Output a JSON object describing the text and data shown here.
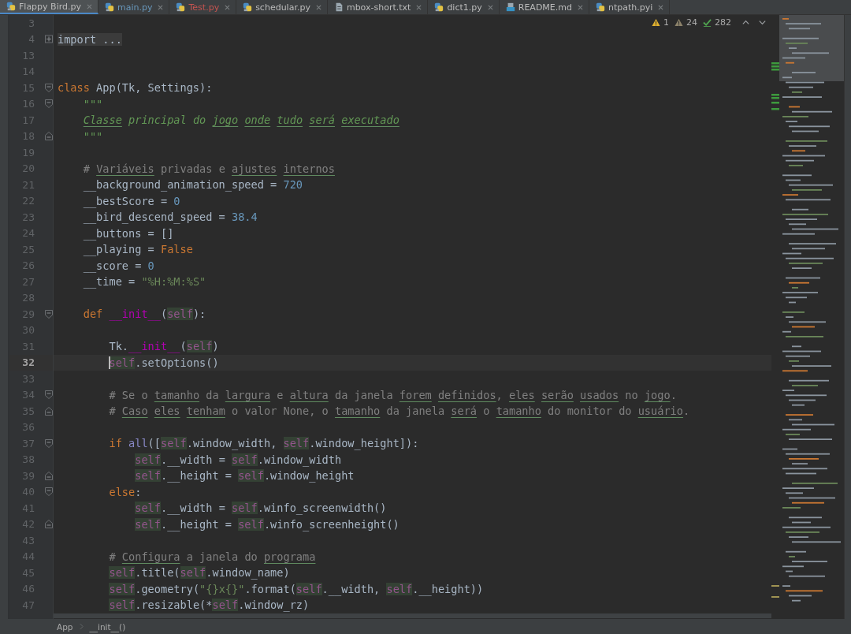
{
  "tabs": [
    {
      "label": "Flappy Bird.py",
      "kind": "py",
      "color": "#bbbbbb",
      "selected": true
    },
    {
      "label": "main.py",
      "kind": "py",
      "color": "#6897bb",
      "selected": false
    },
    {
      "label": "Test.py",
      "kind": "py",
      "color": "#c75450",
      "selected": false
    },
    {
      "label": "schedular.py",
      "kind": "py",
      "color": "#bbbbbb",
      "selected": false
    },
    {
      "label": "mbox-short.txt",
      "kind": "txt",
      "color": "#bbbbbb",
      "selected": false
    },
    {
      "label": "dict1.py",
      "kind": "py",
      "color": "#bbbbbb",
      "selected": false
    },
    {
      "label": "README.md",
      "kind": "md",
      "color": "#bbbbbb",
      "selected": false
    },
    {
      "label": "ntpath.pyi",
      "kind": "py",
      "color": "#bbbbbb",
      "selected": false
    }
  ],
  "inspections": [
    {
      "kind": "warning",
      "count": "1"
    },
    {
      "kind": "weak",
      "count": "24"
    },
    {
      "kind": "typo",
      "count": "282"
    }
  ],
  "lines": [
    {
      "no": "3",
      "current": false
    },
    {
      "no": "4",
      "current": false,
      "fold": {
        "kind": "collapsed"
      },
      "tokens": [
        {
          "t": "import ...",
          "kind": "folded"
        }
      ]
    },
    {
      "no": "13",
      "current": false
    },
    {
      "no": "14",
      "current": false
    },
    {
      "no": "15",
      "current": false,
      "fold": {
        "kind": "open"
      },
      "tokens": [
        {
          "t": "class ",
          "kind": "kw"
        },
        {
          "t": "App(Tk, Settings):",
          "kind": "p"
        }
      ]
    },
    {
      "no": "16",
      "current": false,
      "fold": {
        "kind": "open"
      },
      "tokens": [
        {
          "t": "    \"\"\"",
          "kind": "doc"
        }
      ]
    },
    {
      "no": "17",
      "current": false,
      "tokens": [
        {
          "t": "    Classe",
          "kind": "docu"
        },
        {
          "t": " principal do ",
          "kind": "doc"
        },
        {
          "t": "jogo",
          "kind": "docu"
        },
        {
          "t": " onde",
          "kind": "docu"
        },
        {
          "t": " tudo",
          "kind": "docu"
        },
        {
          "t": " será",
          "kind": "docu"
        },
        {
          "t": " executado",
          "kind": "docu"
        }
      ]
    },
    {
      "no": "18",
      "current": false,
      "fold": {
        "kind": "close"
      },
      "tokens": [
        {
          "t": "    \"\"\"",
          "kind": "doc"
        }
      ]
    },
    {
      "no": "19",
      "current": false
    },
    {
      "no": "20",
      "current": false,
      "tokens": [
        {
          "t": "    # ",
          "kind": "com"
        },
        {
          "t": "Variáveis",
          "kind": "comu"
        },
        {
          "t": " privadas e ",
          "kind": "com"
        },
        {
          "t": "ajustes",
          "kind": "comu"
        },
        {
          "t": " internos",
          "kind": "comu"
        }
      ]
    },
    {
      "no": "21",
      "current": false,
      "tokens": [
        {
          "t": "    __background_animation_speed = ",
          "kind": "p"
        },
        {
          "t": "720",
          "kind": "num"
        }
      ]
    },
    {
      "no": "22",
      "current": false,
      "tokens": [
        {
          "t": "    __bestScore = ",
          "kind": "p"
        },
        {
          "t": "0",
          "kind": "num"
        }
      ]
    },
    {
      "no": "23",
      "current": false,
      "tokens": [
        {
          "t": "    __bird_descend_speed = ",
          "kind": "p"
        },
        {
          "t": "38.4",
          "kind": "num"
        }
      ]
    },
    {
      "no": "24",
      "current": false,
      "tokens": [
        {
          "t": "    __buttons = []",
          "kind": "p"
        }
      ]
    },
    {
      "no": "25",
      "current": false,
      "tokens": [
        {
          "t": "    __playing = ",
          "kind": "p"
        },
        {
          "t": "False",
          "kind": "kw"
        }
      ]
    },
    {
      "no": "26",
      "current": false,
      "tokens": [
        {
          "t": "    __score = ",
          "kind": "p"
        },
        {
          "t": "0",
          "kind": "num"
        }
      ]
    },
    {
      "no": "27",
      "current": false,
      "tokens": [
        {
          "t": "    __time = ",
          "kind": "p"
        },
        {
          "t": "\"%H:%M:%S\"",
          "kind": "str"
        }
      ]
    },
    {
      "no": "28",
      "current": false
    },
    {
      "no": "29",
      "current": false,
      "fold": {
        "kind": "open"
      },
      "tokens": [
        {
          "t": "    def ",
          "kind": "kw"
        },
        {
          "t": "__init__",
          "kind": "magic"
        },
        {
          "t": "(",
          "kind": "p"
        },
        {
          "t": "self",
          "kind": "self"
        },
        {
          "t": "):",
          "kind": "p"
        }
      ]
    },
    {
      "no": "30",
      "current": false
    },
    {
      "no": "31",
      "current": false,
      "tokens": [
        {
          "t": "        Tk.",
          "kind": "p"
        },
        {
          "t": "__init__",
          "kind": "magic"
        },
        {
          "t": "(",
          "kind": "p"
        },
        {
          "t": "self",
          "kind": "self"
        },
        {
          "t": ")",
          "kind": "p"
        }
      ]
    },
    {
      "no": "32",
      "current": true,
      "tokens": [
        {
          "t": "        self",
          "kind": "self"
        },
        {
          "t": ".setOptions()",
          "kind": "p"
        }
      ]
    },
    {
      "no": "33",
      "current": false
    },
    {
      "no": "34",
      "current": false,
      "fold": {
        "kind": "open"
      },
      "tokens": [
        {
          "t": "        # Se o ",
          "kind": "com"
        },
        {
          "t": "tamanho",
          "kind": "comu"
        },
        {
          "t": " da ",
          "kind": "com"
        },
        {
          "t": "largura",
          "kind": "comu"
        },
        {
          "t": " e ",
          "kind": "com"
        },
        {
          "t": "altura",
          "kind": "comu"
        },
        {
          "t": " da janela ",
          "kind": "com"
        },
        {
          "t": "forem",
          "kind": "comu"
        },
        {
          "t": " definidos",
          "kind": "comu"
        },
        {
          "t": ", ",
          "kind": "com"
        },
        {
          "t": "eles",
          "kind": "comu"
        },
        {
          "t": " serão",
          "kind": "comu"
        },
        {
          "t": " usados",
          "kind": "comu"
        },
        {
          "t": " no ",
          "kind": "com"
        },
        {
          "t": "jogo",
          "kind": "comu"
        },
        {
          "t": ".",
          "kind": "com"
        }
      ]
    },
    {
      "no": "35",
      "current": false,
      "fold": {
        "kind": "close"
      },
      "tokens": [
        {
          "t": "        # ",
          "kind": "com"
        },
        {
          "t": "Caso",
          "kind": "comu"
        },
        {
          "t": " eles",
          "kind": "comu"
        },
        {
          "t": " tenham",
          "kind": "comu"
        },
        {
          "t": " o valor None, o ",
          "kind": "com"
        },
        {
          "t": "tamanho",
          "kind": "comu"
        },
        {
          "t": " da janela ",
          "kind": "com"
        },
        {
          "t": "será",
          "kind": "comu"
        },
        {
          "t": " o ",
          "kind": "com"
        },
        {
          "t": "tamanho",
          "kind": "comu"
        },
        {
          "t": " do monitor do ",
          "kind": "com"
        },
        {
          "t": "usuário",
          "kind": "comu"
        },
        {
          "t": ".",
          "kind": "com"
        }
      ]
    },
    {
      "no": "36",
      "current": false
    },
    {
      "no": "37",
      "current": false,
      "fold": {
        "kind": "open"
      },
      "tokens": [
        {
          "t": "        if ",
          "kind": "kw"
        },
        {
          "t": "all",
          "kind": "builtin"
        },
        {
          "t": "([",
          "kind": "p"
        },
        {
          "t": "self",
          "kind": "self"
        },
        {
          "t": ".window_width, ",
          "kind": "p"
        },
        {
          "t": "self",
          "kind": "self"
        },
        {
          "t": ".window_height]):",
          "kind": "p"
        }
      ]
    },
    {
      "no": "38",
      "current": false,
      "tokens": [
        {
          "t": "            self",
          "kind": "self"
        },
        {
          "t": ".__width = ",
          "kind": "p"
        },
        {
          "t": "self",
          "kind": "self"
        },
        {
          "t": ".window_width",
          "kind": "p"
        }
      ]
    },
    {
      "no": "39",
      "current": false,
      "fold": {
        "kind": "close"
      },
      "tokens": [
        {
          "t": "            self",
          "kind": "self"
        },
        {
          "t": ".__height = ",
          "kind": "p"
        },
        {
          "t": "self",
          "kind": "self"
        },
        {
          "t": ".window_height",
          "kind": "p"
        }
      ]
    },
    {
      "no": "40",
      "current": false,
      "fold": {
        "kind": "open"
      },
      "tokens": [
        {
          "t": "        else",
          "kind": "kw"
        },
        {
          "t": ":",
          "kind": "p"
        }
      ]
    },
    {
      "no": "41",
      "current": false,
      "tokens": [
        {
          "t": "            self",
          "kind": "self"
        },
        {
          "t": ".__width = ",
          "kind": "p"
        },
        {
          "t": "self",
          "kind": "self"
        },
        {
          "t": ".winfo_screenwidth()",
          "kind": "p"
        }
      ]
    },
    {
      "no": "42",
      "current": false,
      "fold": {
        "kind": "close"
      },
      "tokens": [
        {
          "t": "            self",
          "kind": "self"
        },
        {
          "t": ".__height = ",
          "kind": "p"
        },
        {
          "t": "self",
          "kind": "self"
        },
        {
          "t": ".winfo_screenheight()",
          "kind": "p"
        }
      ]
    },
    {
      "no": "43",
      "current": false
    },
    {
      "no": "44",
      "current": false,
      "tokens": [
        {
          "t": "        # ",
          "kind": "com"
        },
        {
          "t": "Configura",
          "kind": "comu"
        },
        {
          "t": " a janela do ",
          "kind": "com"
        },
        {
          "t": "programa",
          "kind": "comu"
        }
      ]
    },
    {
      "no": "45",
      "current": false,
      "tokens": [
        {
          "t": "        self",
          "kind": "self"
        },
        {
          "t": ".title(",
          "kind": "p"
        },
        {
          "t": "self",
          "kind": "self"
        },
        {
          "t": ".window_name)",
          "kind": "p"
        }
      ]
    },
    {
      "no": "46",
      "current": false,
      "tokens": [
        {
          "t": "        self",
          "kind": "self"
        },
        {
          "t": ".geometry(",
          "kind": "p"
        },
        {
          "t": "\"{}x{}\"",
          "kind": "str"
        },
        {
          "t": ".format(",
          "kind": "p"
        },
        {
          "t": "self",
          "kind": "self"
        },
        {
          "t": ".__width, ",
          "kind": "p"
        },
        {
          "t": "self",
          "kind": "self"
        },
        {
          "t": ".__height))",
          "kind": "p"
        }
      ]
    },
    {
      "no": "47",
      "current": false,
      "tokens": [
        {
          "t": "        self",
          "kind": "self"
        },
        {
          "t": ".resizable(*",
          "kind": "p"
        },
        {
          "t": "self",
          "kind": "self"
        },
        {
          "t": ".window_rz)",
          "kind": "p"
        }
      ]
    }
  ],
  "breadcrumb": [
    "App",
    "__init__()"
  ]
}
